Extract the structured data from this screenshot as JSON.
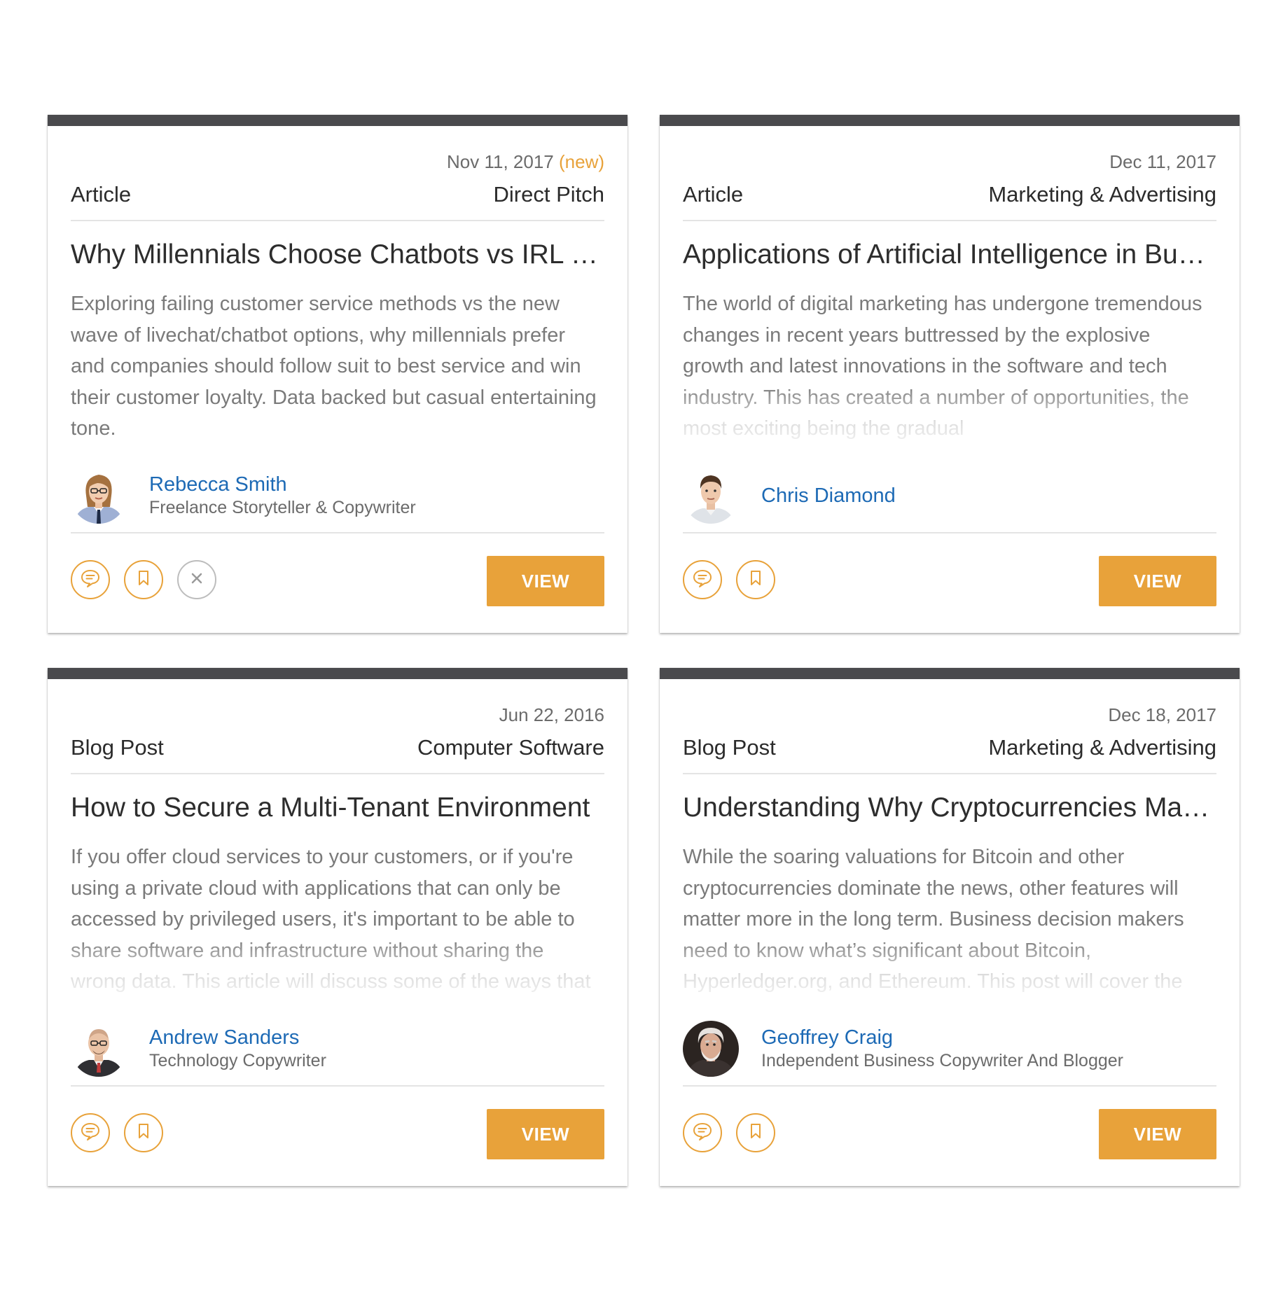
{
  "colors": {
    "accent": "#e8a23a",
    "card_top_bar": "#4a4a4d",
    "author_link": "#1d6ab5",
    "muted_text": "#7a7a7a"
  },
  "cards": [
    {
      "date": "Nov 11, 2017",
      "new_label": "(new)",
      "type": "Article",
      "category": "Direct Pitch",
      "title": "Why Millennials Choose Chatbots vs IRL Customer Service",
      "excerpt": "Exploring failing customer service methods vs the new wave of livechat/chatbot options, why millennials prefer and companies should follow suit to best service and win their customer loyalty. Data backed but casual entertaining tone.",
      "author_name": "Rebecca Smith",
      "author_role": "Freelance Storyteller & Copywriter",
      "view_label": "VIEW",
      "icons": [
        "comment-icon",
        "bookmark-icon",
        "close-icon"
      ]
    },
    {
      "date": "Dec 11, 2017",
      "type": "Article",
      "category": "Marketing & Advertising",
      "title": "Applications of Artificial Intelligence in Business",
      "excerpt": "The world of digital marketing has undergone tremendous changes in recent years buttressed by the explosive growth and latest innovations in the software and tech industry. This has created a number of opportunities, the most exciting being the gradual",
      "author_name": "Chris Diamond",
      "view_label": "VIEW",
      "icons": [
        "comment-icon",
        "bookmark-icon"
      ]
    },
    {
      "date": "Jun 22, 2016",
      "type": "Blog Post",
      "category": "Computer Software",
      "title": "How to Secure a Multi-Tenant Environment",
      "excerpt": "If you offer cloud services to your customers, or if you're using a private cloud with applications that can only be accessed by privileged users, it's important to be able to share software and infrastructure without sharing the wrong data. This article will discuss some of the ways that",
      "author_name": "Andrew Sanders",
      "author_role": "Technology Copywriter",
      "view_label": "VIEW",
      "icons": [
        "comment-icon",
        "bookmark-icon"
      ]
    },
    {
      "date": "Dec 18, 2017",
      "type": "Blog Post",
      "category": "Marketing & Advertising",
      "title": "Understanding Why Cryptocurrencies Matter",
      "excerpt": "While the soaring valuations for Bitcoin and other cryptocurrencies dominate the news, other features will matter more in the long term. Business decision makers need to know what’s significant about Bitcoin, Hyperledger.org, and Ethereum. This post will cover the",
      "author_name": "Geoffrey Craig",
      "author_role": "Independent Business Copywriter And Blogger",
      "view_label": "VIEW",
      "icons": [
        "comment-icon",
        "bookmark-icon"
      ]
    }
  ]
}
